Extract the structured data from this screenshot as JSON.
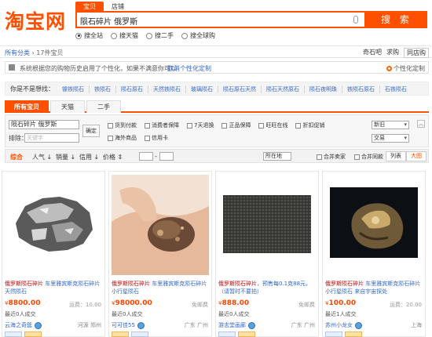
{
  "header": {
    "logo": "淘宝网",
    "search_tabs": [
      "宝贝",
      "店铺"
    ],
    "query": "陨石碎片 俄罗斯",
    "search_button": "搜 索",
    "scopes": [
      "搜全站",
      "搜天猫",
      "搜二手",
      "搜全球购"
    ],
    "selected_scope": 0
  },
  "breadcrumb": {
    "root": "所有分类",
    "count": "17件宝贝",
    "right_items": [
      "奇石吧",
      "求购",
      "同店购"
    ]
  },
  "notice": {
    "text": "系统根据您的购物历史启用了个性化，如果不满意你可以",
    "link": "取消个性化定制",
    "right": "个性化定制"
  },
  "related": {
    "label": "你是不是想找：",
    "items": [
      "镍铁陨石",
      "铁陨石",
      "陨石原石",
      "天然铁陨石",
      "玻璃陨石",
      "陨石原石天然",
      "陨石天然原石",
      "陨石夜明珠",
      "铁陨石原石",
      "石铁陨石"
    ]
  },
  "result_tabs": [
    "所有宝贝",
    "天猫",
    "二手"
  ],
  "filters": {
    "query_value": "陨石碎片 俄罗斯",
    "exclude_label": "排除：",
    "exclude_placeholder": "关键字",
    "ok": "确定",
    "row1": [
      "货到付款",
      "消费者保障",
      "7天退换",
      "正品保障",
      "旺旺在线",
      "折扣促销"
    ],
    "row2": [
      "海外商品",
      "信用卡"
    ],
    "select1": "新旧",
    "select2": "交易"
  },
  "sortbar": {
    "items": [
      "综合",
      "人气",
      "销量",
      "信用",
      "价格"
    ],
    "location": "所在地",
    "merge_seller": "合并卖家",
    "merge_same": "合并同款",
    "list_view": "列表",
    "grid_view": "大图"
  },
  "products": [
    {
      "title_a": "俄罗斯陨石碎片",
      "title_b": "车里雅宾斯克陨石碎片天然陨石",
      "price": "8800.00",
      "ship": "运费：10.00",
      "deals": "最近0人成交",
      "shop": "云海之奇筵",
      "location": "河源 郑州"
    },
    {
      "title_a": "俄罗斯陨石碎片",
      "title_b": "车里雅宾斯克陨石碎片小行星陨石",
      "price": "98000.00",
      "ship": "免邮费",
      "deals": "最近0人成交",
      "shop": "可可佳55",
      "location": "广东 广州"
    },
    {
      "title_a": "俄罗斯陨石碎片",
      "title_b": "，预售每0.1克88元，（请暂时不要拍）",
      "price": "888.00",
      "ship": "免邮费",
      "deals": "最近0人成交",
      "shop": "游志堂画廊",
      "location": "广东 广州"
    },
    {
      "title_a": "俄罗斯陨石碎片",
      "title_b": "车里雅宾斯克陨石碎片小行星陨石 来自宇宙探处",
      "price": "100.00",
      "ship": "运费：20.00",
      "deals": "最近1人成交",
      "shop": "苏州小龙女",
      "location": "上海"
    }
  ],
  "colors": {
    "brand": "#ff5000",
    "link": "#3366cc",
    "price": "#ff4400"
  }
}
